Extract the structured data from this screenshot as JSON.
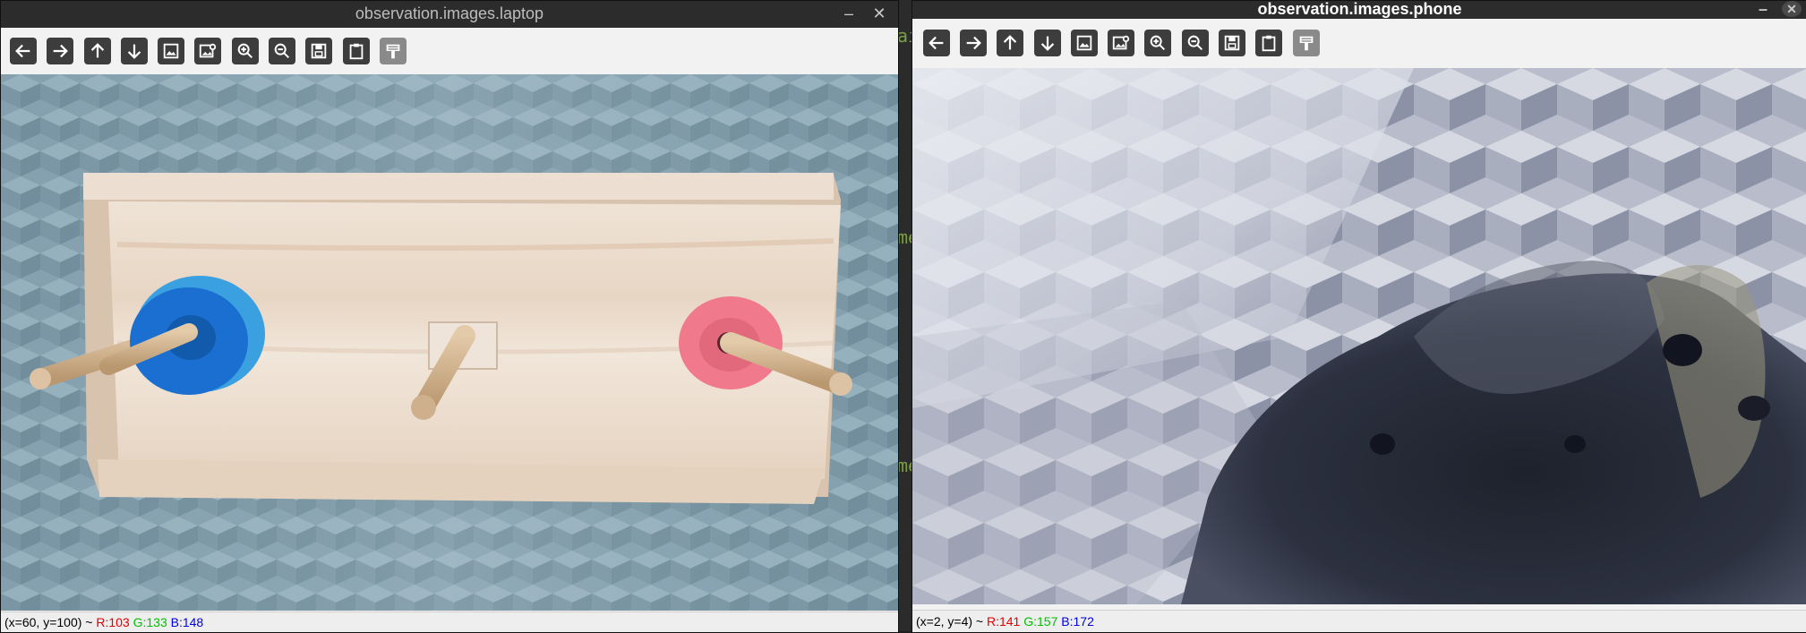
{
  "windows": {
    "laptop": {
      "title": "observation.images.laptop",
      "minimize_glyph": "–",
      "close_glyph": "✕",
      "status": {
        "coords": "(x=60, y=100) ~",
        "r": "R:103",
        "g": "G:133",
        "b": "B:148"
      }
    },
    "phone": {
      "title": "observation.images.phone",
      "minimize_glyph": "–",
      "close_glyph": "✕",
      "status": {
        "coords": "(x=2, y=4) ~",
        "r": "R:141",
        "g": "G:157",
        "b": "B:172"
      }
    }
  },
  "toolbar": {
    "buttons": [
      {
        "name": "back-icon",
        "enabled": true
      },
      {
        "name": "forward-icon",
        "enabled": true
      },
      {
        "name": "up-arrow-icon",
        "enabled": true
      },
      {
        "name": "down-arrow-icon",
        "enabled": true
      },
      {
        "name": "image-icon",
        "enabled": true
      },
      {
        "name": "image-settings-icon",
        "enabled": true
      },
      {
        "name": "zoom-in-icon",
        "enabled": true
      },
      {
        "name": "zoom-out-icon",
        "enabled": true
      },
      {
        "name": "save-icon",
        "enabled": true
      },
      {
        "name": "clipboard-icon",
        "enabled": true
      },
      {
        "name": "properties-icon",
        "enabled": false
      }
    ]
  },
  "background_fragments": [
    "ai",
    "me",
    "me"
  ],
  "colors": {
    "title_bar": "#2c2c2c",
    "toolbar_button": "#3d3d3d",
    "status_r": "#e00000",
    "status_g": "#00c000",
    "status_b": "#0000e0",
    "ring_blue": "#1a6fd1",
    "ring_pink": "#f07a8c"
  }
}
